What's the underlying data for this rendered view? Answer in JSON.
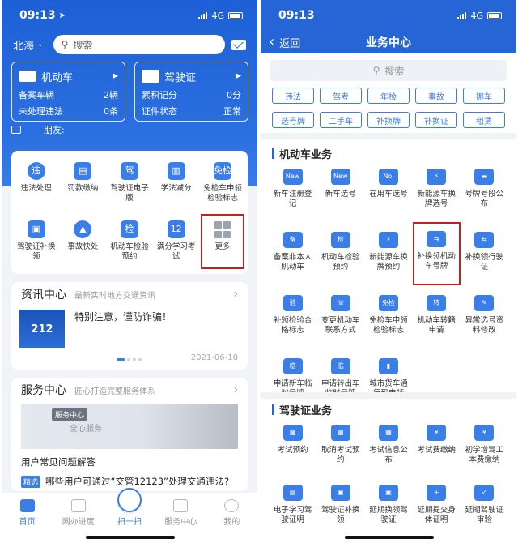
{
  "left": {
    "status": {
      "time": "09:13",
      "network": "4G"
    },
    "header": {
      "city": "北海",
      "search_placeholder": "搜索"
    },
    "vehicle_card": {
      "title": "机动车",
      "rows": [
        {
          "label": "备案车辆",
          "value": "2辆"
        },
        {
          "label": "未处理违法",
          "value": "0条"
        }
      ]
    },
    "license_card": {
      "title": "驾驶证",
      "rows": [
        {
          "label": "累积记分",
          "value": "0分"
        },
        {
          "label": "证件状态",
          "value": "正常"
        }
      ]
    },
    "notice": "朋友:",
    "services": [
      {
        "label": "违法处理",
        "glyph": "违",
        "icon": "violation-icon"
      },
      {
        "label": "罚款缴纳",
        "glyph": "▤",
        "icon": "fine-icon"
      },
      {
        "label": "驾驶证电子版",
        "glyph": "驾",
        "icon": "e-license-icon"
      },
      {
        "label": "学法减分",
        "glyph": "▥",
        "icon": "study-icon"
      },
      {
        "label": "免检车申领检验标志",
        "glyph": "免检",
        "icon": "exempt-badge-icon"
      },
      {
        "label": "驾驶证补换领",
        "glyph": "▣",
        "icon": "license-renew-icon"
      },
      {
        "label": "事故快处",
        "glyph": "▲",
        "icon": "accident-icon"
      },
      {
        "label": "机动车检验预约",
        "glyph": "检",
        "icon": "inspection-icon"
      },
      {
        "label": "满分学习考试",
        "glyph": "12",
        "icon": "exam-icon"
      },
      {
        "label": "更多",
        "glyph": "",
        "icon": "more-grid-icon"
      }
    ],
    "info_center": {
      "title": "资讯中心",
      "subtitle": "最新实时地方交通资讯",
      "news_title": "特别注意，谨防诈骗！",
      "thumb_text": "212",
      "date": "2021-06-18"
    },
    "service_center": {
      "title": "服务中心",
      "subtitle": "匠心打造完整服务体系",
      "banner_tag": "服务中心",
      "banner_text": "全心服务",
      "faq_1": "用户常见问题解答",
      "faq_tag": "精选",
      "faq_2": "哪些用户可通过“交管12123”处理交通违法?"
    },
    "tabs": [
      "首页",
      "网办进度",
      "扫一扫",
      "服务中心",
      "我的"
    ]
  },
  "right": {
    "status": {
      "time": "09:13",
      "network": "4G"
    },
    "nav": {
      "back": "返回",
      "title": "业务中心"
    },
    "search_placeholder": "搜索",
    "chips": [
      "违法",
      "驾考",
      "年检",
      "事故",
      "挪车",
      "选号牌",
      "二手车",
      "补换牌",
      "补换证",
      "租赁"
    ],
    "section_vehicle": "机动车业务",
    "vehicle_items": [
      {
        "label": "新车注册登记",
        "glyph": "New"
      },
      {
        "label": "新车选号",
        "glyph": "New"
      },
      {
        "label": "在用车选号",
        "glyph": "No."
      },
      {
        "label": "新能源车换牌选号",
        "glyph": "⚡"
      },
      {
        "label": "号牌号段公布",
        "glyph": "▬"
      },
      {
        "label": "备案非本人机动车",
        "glyph": "备"
      },
      {
        "label": "机动车检验预约",
        "glyph": "检"
      },
      {
        "label": "新能源车换牌预约",
        "glyph": "⚡"
      },
      {
        "label": "补换领机动车号牌",
        "glyph": "⇆"
      },
      {
        "label": "补换领行驶证",
        "glyph": "⇆"
      },
      {
        "label": "补领检验合格标志",
        "glyph": "验"
      },
      {
        "label": "变更机动车联系方式",
        "glyph": "☏"
      },
      {
        "label": "免检车申领检验标志",
        "glyph": "免检"
      },
      {
        "label": "机动车转籍申请",
        "glyph": "转"
      },
      {
        "label": "异常选号资料修改",
        "glyph": "✎"
      },
      {
        "label": "申请新车临时号牌",
        "glyph": "临"
      },
      {
        "label": "申请转出车临时号牌",
        "glyph": "临"
      },
      {
        "label": "城市货车通行码申领",
        "glyph": "▮"
      }
    ],
    "section_license": "驾驶证业务",
    "license_items": [
      {
        "label": "考试预约",
        "glyph": "▦"
      },
      {
        "label": "取消考试预约",
        "glyph": "▦"
      },
      {
        "label": "考试信息公布",
        "glyph": "▦"
      },
      {
        "label": "考试费缴纳",
        "glyph": "¥"
      },
      {
        "label": "初学增驾工本费缴纳",
        "glyph": "¥"
      },
      {
        "label": "电子学习驾驶证明",
        "glyph": "▤"
      },
      {
        "label": "驾驶证补换领",
        "glyph": "▣"
      },
      {
        "label": "延期换领驾驶证",
        "glyph": "▣"
      },
      {
        "label": "延期提交身体证明",
        "glyph": "+"
      },
      {
        "label": "延期驾驶证审验",
        "glyph": "✓"
      }
    ]
  }
}
